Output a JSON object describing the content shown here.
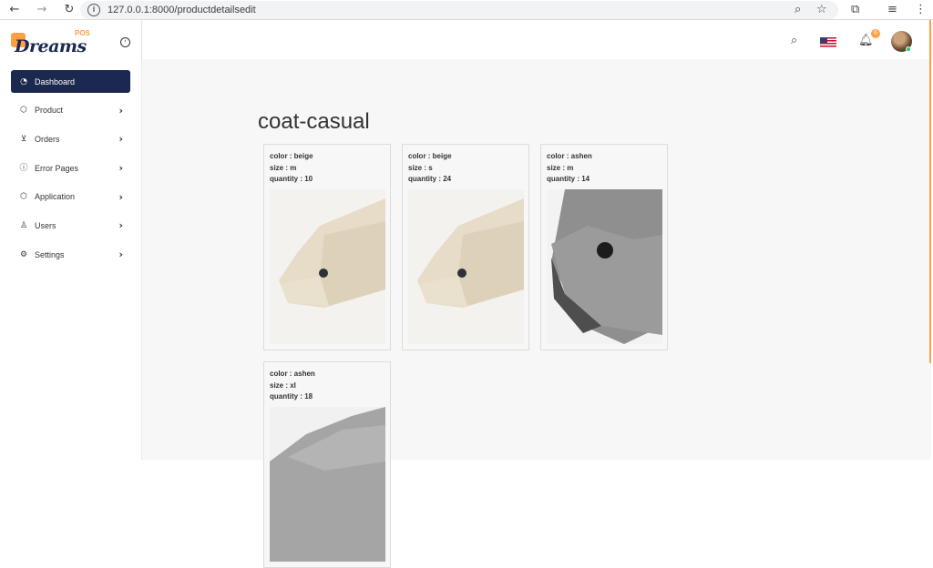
{
  "browser": {
    "url": "127.0.0.1:8000/productdetailsedit"
  },
  "sidebar": {
    "logo_word": "Dreams",
    "logo_pos": "POS",
    "items": [
      {
        "label": "Dashboard",
        "icon": "gauge-icon",
        "active": true
      },
      {
        "label": "Product",
        "icon": "box-icon"
      },
      {
        "label": "Orders",
        "icon": "cart-icon"
      },
      {
        "label": "Error Pages",
        "icon": "alert-circle-icon"
      },
      {
        "label": "Application",
        "icon": "cube-icon"
      },
      {
        "label": "Users",
        "icon": "user-icon"
      },
      {
        "label": "Settings",
        "icon": "gear-icon"
      }
    ]
  },
  "header": {
    "notification_count": "6"
  },
  "main": {
    "title": "coat-casual",
    "variants": [
      {
        "color": "color : beige",
        "size": "size : m",
        "quantity": "quantity : 10",
        "swatch": "#e8e0d0"
      },
      {
        "color": "color : beige",
        "size": "size : s",
        "quantity": "quantity : 24",
        "swatch": "#e8e0d0"
      },
      {
        "color": "color : ashen",
        "size": "size : m",
        "quantity": "quantity : 14",
        "swatch": "#9a9a9a"
      },
      {
        "color": "color : ashen",
        "size": "size : xl",
        "quantity": "quantity : 18",
        "swatch": "#a4a4a4"
      }
    ]
  },
  "colors": {
    "brand_dark": "#1b2850",
    "accent_orange": "#ff9f43"
  }
}
